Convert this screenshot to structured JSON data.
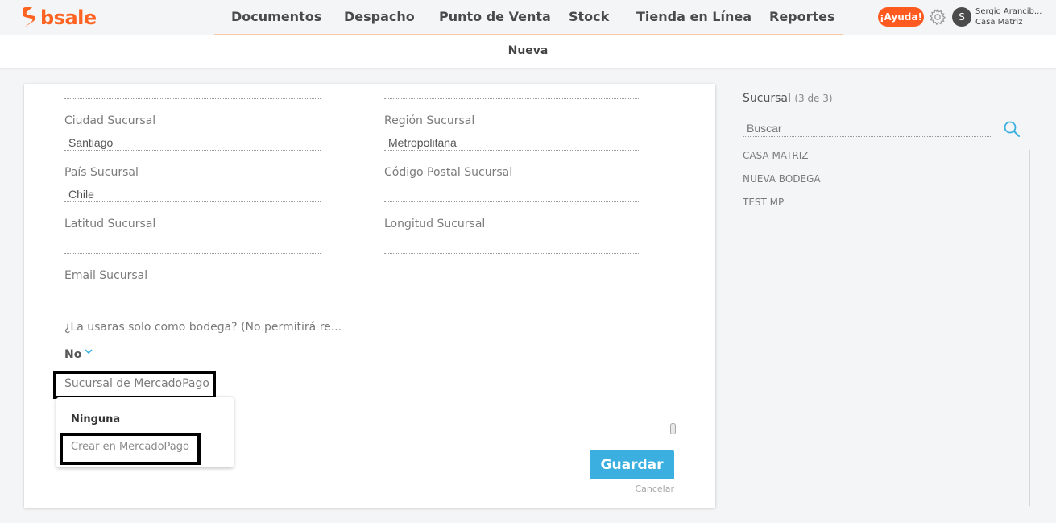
{
  "app": {
    "brand": "bsale",
    "brand_color": "#ff6321"
  },
  "nav": {
    "items": [
      {
        "label": "Documentos"
      },
      {
        "label": "Despacho"
      },
      {
        "label": "Punto de Venta"
      },
      {
        "label": "Stock"
      },
      {
        "label": "Tienda en Línea"
      },
      {
        "label": "Reportes"
      }
    ]
  },
  "header": {
    "help_label": "¡Ayuda!",
    "help_color": "#ff5a1f",
    "settings_icon": "gear-icon",
    "user_initial": "S",
    "user_name": "Sergio Arancib...",
    "user_branch": "Casa Matriz"
  },
  "page": {
    "title": "Nueva"
  },
  "form": {
    "ciudad": {
      "label": "Ciudad Sucursal",
      "value": "Santiago"
    },
    "region": {
      "label": "Región Sucursal",
      "value": "Metropolitana"
    },
    "pais": {
      "label": "País Sucursal",
      "value": "Chile"
    },
    "codigo_postal": {
      "label": "Código Postal Sucursal",
      "value": ""
    },
    "latitud": {
      "label": "Latitud Sucursal",
      "value": ""
    },
    "longitud": {
      "label": "Longitud Sucursal",
      "value": ""
    },
    "email": {
      "label": "Email Sucursal",
      "value": ""
    },
    "bodega": {
      "label": "¿La usaras solo como bodega? (No permitirá re...",
      "value": "No"
    },
    "mercadopago": {
      "label": "Sucursal de MercadoPago",
      "options": [
        "Ninguna",
        "Crear en MercadoPago"
      ]
    },
    "save_label": "Guardar",
    "save_color": "#3bb0e0",
    "cancel_label": "Cancelar"
  },
  "sidebar": {
    "title": "Sucursal",
    "count": "(3 de 3)",
    "search_placeholder": "Buscar",
    "items": [
      {
        "label": "CASA MATRIZ"
      },
      {
        "label": "NUEVA BODEGA"
      },
      {
        "label": "TEST MP"
      }
    ]
  }
}
